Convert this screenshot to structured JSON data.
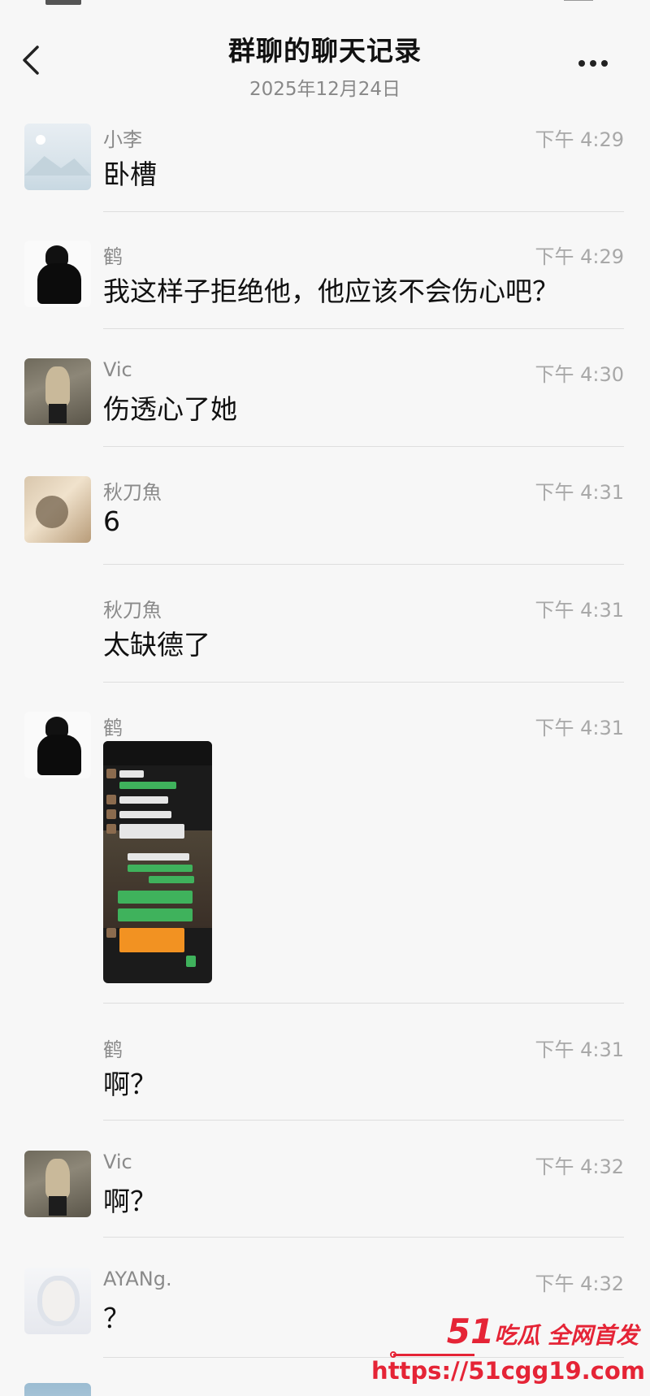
{
  "header": {
    "title": "群聊的聊天记录",
    "date": "2025年12月24日"
  },
  "messages": [
    {
      "sender": "小李",
      "time": "下午 4:29",
      "text": "卧槽",
      "avatar": "landscape-placeholder"
    },
    {
      "sender": "鹤",
      "time": "下午 4:29",
      "text": "我这样子拒绝他，他应该不会伤心吧？",
      "avatar": "black-outfit-person"
    },
    {
      "sender": "Vic",
      "time": "下午 4:30",
      "text": "伤透心了她",
      "avatar": "person-photo"
    },
    {
      "sender": "秋刀魚",
      "time": "下午 4:31",
      "text": "6",
      "avatar": "cat-photo"
    },
    {
      "sender": "秋刀魚",
      "time": "下午 4:31",
      "text": "太缺德了"
    },
    {
      "sender": "鹤",
      "time": "下午 4:31",
      "image": "chat-screenshot-thumbnail",
      "avatar": "black-outfit-person"
    },
    {
      "sender": "鹤",
      "time": "下午 4:31",
      "text": "啊？"
    },
    {
      "sender": "Vic",
      "time": "下午 4:32",
      "text": "啊？",
      "avatar": "person-photo"
    },
    {
      "sender": "AYANg.",
      "time": "下午 4:32",
      "text": "？",
      "avatar": "anime-white-hair"
    }
  ],
  "watermark": {
    "brand_number": "51",
    "brand_text": "吃瓜 全网首发",
    "url": "https://51cgg19.com",
    "color": "#e52436"
  },
  "icons": [
    "back-chevron-icon",
    "more-dots-icon"
  ]
}
